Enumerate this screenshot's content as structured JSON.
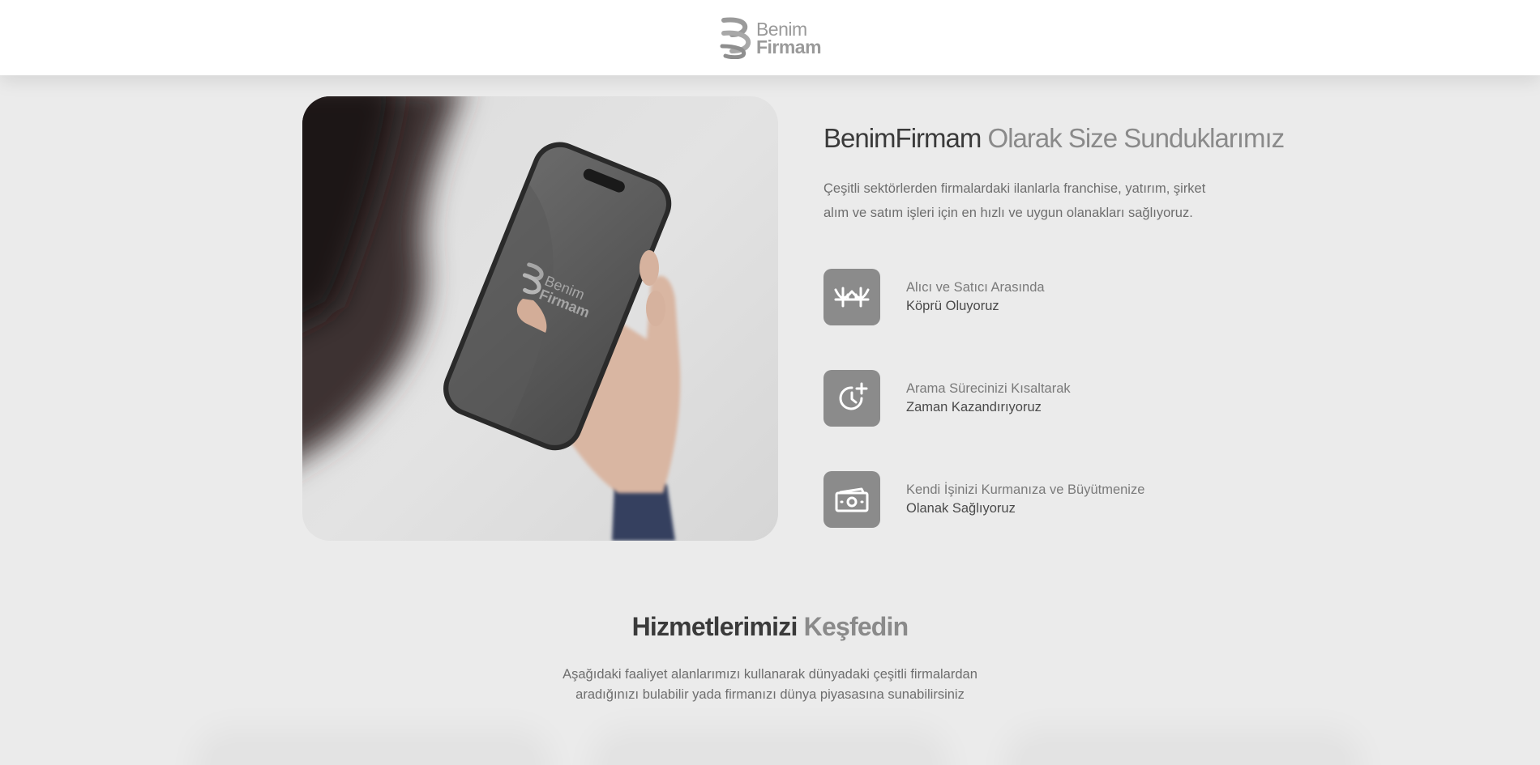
{
  "header": {
    "logo": {
      "line1": "Benim",
      "line2": "Firmam",
      "icon": "benimfirmam-logo-icon"
    }
  },
  "hero": {
    "image_alt": "Hand holding phone showing BenimFirmam logo",
    "phone_logo": {
      "line1": "Benim",
      "line2": "Firmam"
    }
  },
  "about": {
    "title_strong": "BenimFirmam",
    "title_light": " Olarak Size Sunduklarımız",
    "description": "Çeşitli sektörlerden firmalardaki ilanlarla franchise, yatırım, şirket alım ve satım işleri için en hızlı ve uygun olanakları sağlıyoruz.",
    "features": [
      {
        "icon": "bridge-icon",
        "line1": "Alıcı ve Satıcı Arasında",
        "line2": "Köprü Oluyoruz"
      },
      {
        "icon": "clock-plus-icon",
        "line1": "Arama Sürecinizi Kısaltarak",
        "line2": "Zaman Kazandırıyoruz"
      },
      {
        "icon": "money-icon",
        "line1": "Kendi İşinizi Kurmanıza ve Büyütmenize",
        "line2": "Olanak Sağlıyoruz"
      }
    ]
  },
  "services": {
    "title_strong": "Hizmetlerimizi",
    "title_light": " Keşfedin",
    "description_line1": "Aşağıdaki faaliyet alanlarımızı kullanarak dünyadaki çeşitli firmalardan",
    "description_line2": "aradığınızı bulabilir yada firmanızı dünya piyasasına sunabilirsiniz"
  },
  "colors": {
    "page_bg": "#ebebeb",
    "header_bg": "#ffffff",
    "icon_tile": "#8b8b8b",
    "title_dark": "#3a3a3a",
    "title_light": "#8a8a8a"
  }
}
